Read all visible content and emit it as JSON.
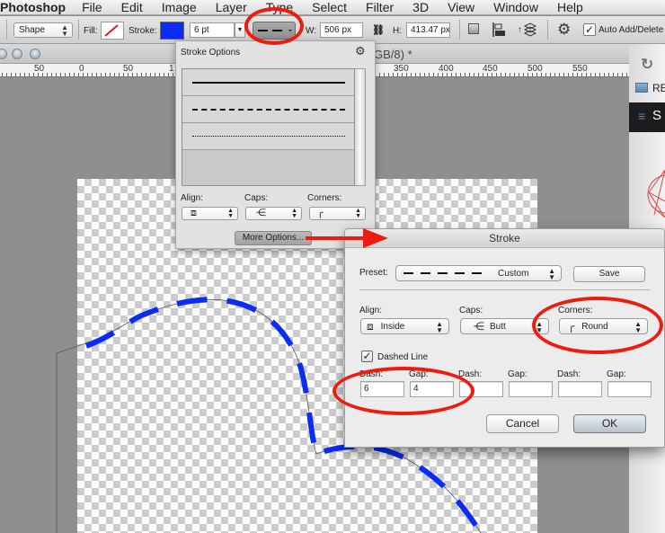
{
  "menubar": {
    "app": "Photoshop",
    "items": [
      "File",
      "Edit",
      "Image",
      "Layer",
      "Type",
      "Select",
      "Filter",
      "3D",
      "View",
      "Window",
      "Help"
    ]
  },
  "optionsbar": {
    "tool_mode": "Shape",
    "fill_label": "Fill:",
    "stroke_label": "Stroke:",
    "stroke_color": "#0a2cf5",
    "stroke_width": "6 pt",
    "w_label": "W:",
    "w_value": "506 px",
    "h_label": "H:",
    "h_value": "413.47 px",
    "auto_add_delete_label": "Auto Add/Delete",
    "auto_add_delete_checked": true
  },
  "document": {
    "tab_title_suffix": "GB/8) *",
    "ruler_labels": [
      "50",
      "0",
      "50",
      "1",
      "350",
      "400",
      "450",
      "500",
      "550"
    ]
  },
  "right_panel": {
    "item1": "RE",
    "item2": "S"
  },
  "stroke_options_popover": {
    "title": "Stroke Options",
    "presets": [
      "solid",
      "dashed",
      "dotted"
    ],
    "align_label": "Align:",
    "caps_label": "Caps:",
    "corners_label": "Corners:",
    "more_options_label": "More Options..."
  },
  "stroke_dialog": {
    "title": "Stroke",
    "preset_label": "Preset:",
    "preset_value": "Custom",
    "save_label": "Save",
    "align_label": "Align:",
    "align_value": "Inside",
    "caps_label": "Caps:",
    "caps_value": "Butt",
    "corners_label": "Corners:",
    "corners_value": "Round",
    "dashed_line_label": "Dashed Line",
    "dashed_line_checked": true,
    "dash_fields": [
      {
        "label": "Dash:",
        "value": "6"
      },
      {
        "label": "Gap:",
        "value": "4"
      },
      {
        "label": "Dash:",
        "value": ""
      },
      {
        "label": "Gap:",
        "value": ""
      },
      {
        "label": "Dash:",
        "value": ""
      },
      {
        "label": "Gap:",
        "value": ""
      }
    ],
    "cancel_label": "Cancel",
    "ok_label": "OK"
  },
  "annotations": {
    "highlight_color": "#ee1c0e"
  }
}
